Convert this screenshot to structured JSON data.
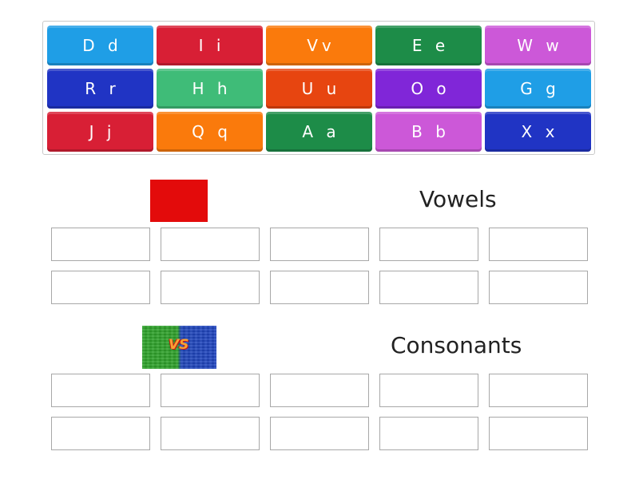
{
  "tiles": [
    {
      "label": "D d",
      "color": "#1f9ee6"
    },
    {
      "label": "I i",
      "color": "#d81f35"
    },
    {
      "label": "Vv",
      "color": "#fa7a0c"
    },
    {
      "label": "E e",
      "color": "#1d8c48"
    },
    {
      "label": "W w",
      "color": "#cc58d8"
    },
    {
      "label": "R r",
      "color": "#2034c4"
    },
    {
      "label": "H h",
      "color": "#3fbc78"
    },
    {
      "label": "U u",
      "color": "#e74510"
    },
    {
      "label": "O o",
      "color": "#8026d8"
    },
    {
      "label": "G g",
      "color": "#1f9ee6"
    },
    {
      "label": "J j",
      "color": "#d81f35"
    },
    {
      "label": "Q q",
      "color": "#fa7a0c"
    },
    {
      "label": "A a",
      "color": "#1d8c48"
    },
    {
      "label": "B b",
      "color": "#cc58d8"
    },
    {
      "label": "X x",
      "color": "#2034c4"
    }
  ],
  "groups": [
    {
      "heading": "Vowels",
      "image": "red-square-image",
      "slot_count": 10
    },
    {
      "heading": "Consonants",
      "image": "vs-image",
      "slot_count": 10
    }
  ],
  "vs_image_text": "VS"
}
